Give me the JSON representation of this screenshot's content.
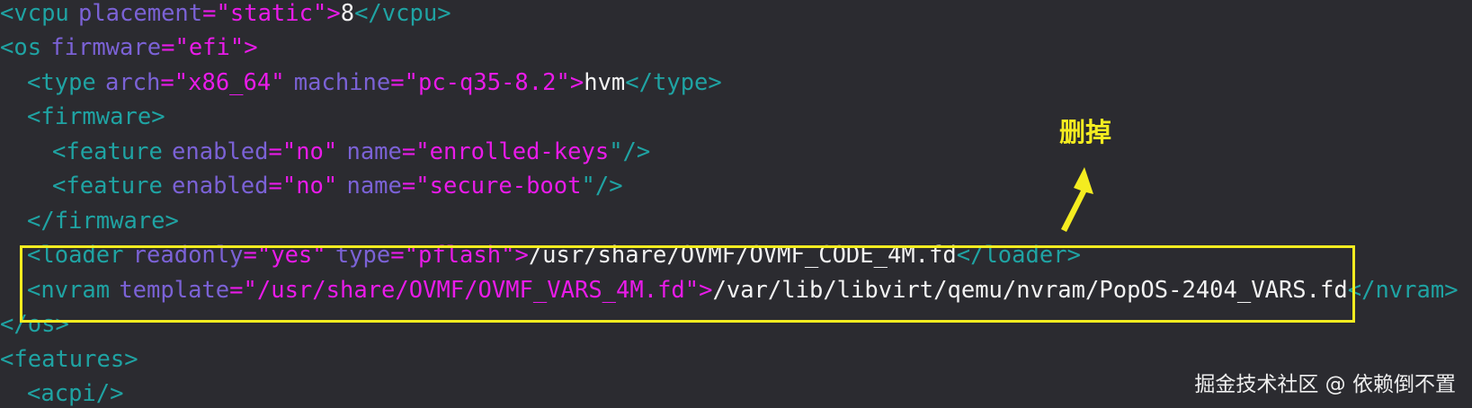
{
  "code": {
    "line1": {
      "open": "<",
      "tag": "vcpu",
      "attr1": "placement",
      "eq": "=\"",
      "val1": "static",
      "close": "\">",
      "text": "8",
      "end_open": "</",
      "end_tag": "vcpu",
      "end_close": ">"
    },
    "line2": {
      "open": "<",
      "tag": "os",
      "attr1": "firmware",
      "eq": "=\"",
      "val1": "efi",
      "close": "\">"
    },
    "line3": {
      "open": "<",
      "tag": "type",
      "attr1": "arch",
      "eq1": "=\"",
      "val1": "x86_64",
      "q1": "\"",
      "attr2": "machine",
      "eq2": "=\"",
      "val2": "pc-q35-8.2",
      "close": "\">",
      "text": "hvm",
      "end_open": "</",
      "end_tag": "type",
      "end_close": ">"
    },
    "line4": {
      "open": "<",
      "tag": "firmware",
      "close": ">"
    },
    "line5": {
      "open": "<",
      "tag": "feature",
      "attr1": "enabled",
      "eq1": "=\"",
      "val1": "no",
      "q1": "\"",
      "attr2": "name",
      "eq2": "=\"",
      "val2": "enrolled-keys",
      "close": "\"/>"
    },
    "line6": {
      "open": "<",
      "tag": "feature",
      "attr1": "enabled",
      "eq1": "=\"",
      "val1": "no",
      "q1": "\"",
      "attr2": "name",
      "eq2": "=\"",
      "val2": "secure-boot",
      "close": "\"/>"
    },
    "line7": {
      "open": "</",
      "tag": "firmware",
      "close": ">"
    },
    "line8": {
      "open": "<",
      "tag": "loader",
      "attr1": "readonly",
      "eq1": "=\"",
      "val1": "yes",
      "q1": "\"",
      "attr2": "type",
      "eq2": "=\"",
      "val2": "pflash",
      "close": "\">",
      "text": "/usr/share/OVMF/OVMF_CODE_4M.fd",
      "end_open": "</",
      "end_tag": "loader",
      "end_close": ">"
    },
    "line9": {
      "open": "<",
      "tag": "nvram",
      "attr1": "template",
      "eq1": "=\"",
      "val1": "/usr/share/OVMF/OVMF_VARS_4M.fd",
      "close": "\">",
      "text": "/var/lib/libvirt/qemu/nvram/PopOS-2404_VARS.fd",
      "end_open": "</",
      "end_tag": "nvram",
      "end_close": ">"
    },
    "line10": {
      "open": "</",
      "tag": "os",
      "close": ">"
    },
    "line11": {
      "open": "<",
      "tag": "features",
      "close": ">"
    },
    "line12": {
      "open": "<",
      "tag": "acpi",
      "close": "/>"
    }
  },
  "annotation": {
    "label": "删掉",
    "color": "#f4ec20"
  },
  "watermark": "掘金技术社区 @ 依赖倒不置",
  "colors": {
    "background": "#2b2b30",
    "tag": "#1fa3a3",
    "attribute": "#7b62d6",
    "string": "#e91be9",
    "text": "#f2f2f2"
  }
}
